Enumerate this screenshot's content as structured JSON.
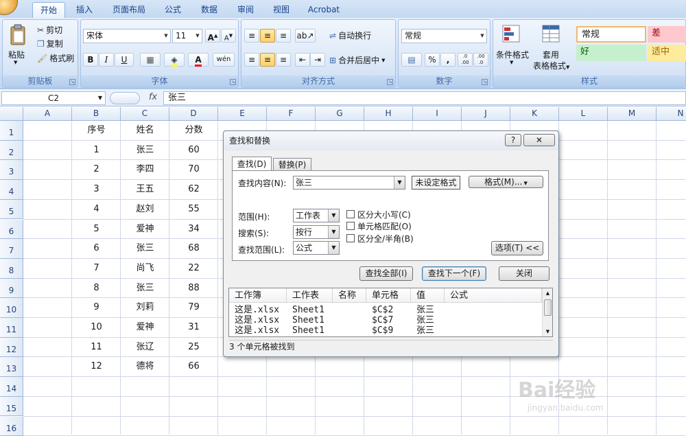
{
  "ribbon": {
    "tabs": [
      "开始",
      "插入",
      "页面布局",
      "公式",
      "数据",
      "审阅",
      "视图",
      "Acrobat"
    ],
    "clipboard": {
      "paste": "粘贴",
      "cut": "剪切",
      "copy": "复制",
      "format_painter": "格式刷",
      "label": "剪贴板"
    },
    "font": {
      "name": "宋体",
      "size": "11",
      "bold": "B",
      "italic": "I",
      "underline": "U",
      "font_color": "A",
      "pinyin": "wén",
      "label": "字体",
      "grow": "A",
      "shrink": "A"
    },
    "alignment": {
      "wrap": "自动换行",
      "merge": "合并后居中",
      "label": "对齐方式"
    },
    "number": {
      "format": "常规",
      "percent": "%",
      "comma": ",",
      "inc": ".0 .00",
      "dec": ".00 .0",
      "label": "数字"
    },
    "styles": {
      "conditional": "条件格式",
      "table_format_1": "套用",
      "table_format_2": "表格格式",
      "normal": "常规",
      "bad": "差",
      "good": "好",
      "neutral": "适中",
      "label": "样式"
    },
    "colors": {
      "bad_bg": "#ffc7ce",
      "bad_fg": "#9c0006",
      "good_bg": "#c6efce",
      "good_fg": "#006100",
      "neutral_bg": "#ffeb9c",
      "neutral_fg": "#9c6500"
    }
  },
  "formula_bar": {
    "name_box": "C2",
    "fx": "fx",
    "value": "张三"
  },
  "sheet": {
    "columns": [
      "A",
      "B",
      "C",
      "D",
      "E",
      "F",
      "G",
      "H",
      "I",
      "J",
      "K",
      "L",
      "M",
      "N"
    ],
    "rows": [
      "1",
      "2",
      "3",
      "4",
      "5",
      "6",
      "7",
      "8",
      "9",
      "10",
      "11",
      "12",
      "13",
      "14",
      "15",
      "16"
    ],
    "headers": {
      "b": "序号",
      "c": "姓名",
      "d": "分数"
    },
    "data": [
      {
        "no": "1",
        "name": "张三",
        "score": "60"
      },
      {
        "no": "2",
        "name": "李四",
        "score": "70"
      },
      {
        "no": "3",
        "name": "王五",
        "score": "62"
      },
      {
        "no": "4",
        "name": "赵刘",
        "score": "55"
      },
      {
        "no": "5",
        "name": "爱神",
        "score": "34"
      },
      {
        "no": "6",
        "name": "张三",
        "score": "68"
      },
      {
        "no": "7",
        "name": "尚飞",
        "score": "22"
      },
      {
        "no": "8",
        "name": "张三",
        "score": "88"
      },
      {
        "no": "9",
        "name": "刘莉",
        "score": "79"
      },
      {
        "no": "10",
        "name": "爱神",
        "score": "31"
      },
      {
        "no": "11",
        "name": "张辽",
        "score": "25"
      },
      {
        "no": "12",
        "name": "德将",
        "score": "66"
      }
    ]
  },
  "dialog": {
    "title": "查找和替换",
    "help": "?",
    "close": "✕",
    "tab_find": "查找(D)",
    "tab_replace": "替换(P)",
    "find_label": "查找内容(N):",
    "find_value": "张三",
    "no_format": "未设定格式",
    "format_btn": "格式(M)...",
    "within_label": "范围(H):",
    "within_value": "工作表",
    "search_label": "搜索(S):",
    "search_value": "按行",
    "lookin_label": "查找范围(L):",
    "lookin_value": "公式",
    "match_case": "区分大小写(C)",
    "match_cell": "单元格匹配(O)",
    "match_byte": "区分全/半角(B)",
    "options_btn": "选项(T) <<",
    "find_all": "查找全部(I)",
    "find_next": "查找下一个(F)",
    "close_btn": "关闭",
    "result_headers": [
      "工作簿",
      "工作表",
      "名称",
      "单元格",
      "值",
      "公式"
    ],
    "results": [
      {
        "book": "这是.xlsx",
        "sheet": "Sheet1",
        "cell": "$C$2",
        "value": "张三"
      },
      {
        "book": "这是.xlsx",
        "sheet": "Sheet1",
        "cell": "$C$7",
        "value": "张三"
      },
      {
        "book": "这是.xlsx",
        "sheet": "Sheet1",
        "cell": "$C$9",
        "value": "张三"
      }
    ],
    "status": "3 个单元格被找到"
  },
  "watermark": {
    "brand": "Bai经验",
    "url": "jingyan.baidu.com"
  }
}
